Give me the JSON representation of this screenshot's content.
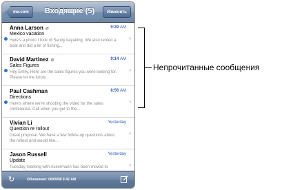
{
  "navbar": {
    "back_label": "me.com",
    "title": "Входящие (5)",
    "edit_label": "Изменить"
  },
  "messages": [
    {
      "sender": "Anna Larson",
      "attachment": true,
      "time": "9:39",
      "ampm": "AM",
      "subject": "Mexico vacation",
      "preview": "Here's a photo I took of Sandy kayaking. We also rented a boat and did a lot of fishing...",
      "unread": true
    },
    {
      "sender": "David Martinez",
      "attachment": true,
      "time": "9:14",
      "ampm": "AM",
      "subject": "Sales Figures",
      "preview": "Hey Emily, Here are the sales figures you were looking for. Please let me know...",
      "unread": true
    },
    {
      "sender": "Paul Cashman",
      "attachment": false,
      "time": "8:56",
      "ampm": "AM",
      "subject": "Directions",
      "preview": "Here's where we're shooting the video for the sales conference. Call when you get to the...",
      "unread": true
    },
    {
      "sender": "Vivian Li",
      "attachment": false,
      "time": "Yesterday",
      "ampm": "",
      "subject": "Question re rollout",
      "preview": "Great proposal. We have a few follow-up questions about the rollout and would like...",
      "unread": false
    },
    {
      "sender": "Jason Russell",
      "attachment": false,
      "time": "Yesterday",
      "ampm": "",
      "subject": "Update",
      "preview": "Tuesday meeting with Ackermann has been moved to Wednesday...",
      "unread": false
    }
  ],
  "toolbar": {
    "updated_text": "Обновлено: 06/09/08 9:42 AM"
  },
  "callout": "Непрочитанные сообщения",
  "colors": {
    "unread_dot": "#2f6fd6",
    "time_blue": "#2a5bbf"
  },
  "icons": {
    "refresh": "refresh-icon",
    "compose": "compose-icon",
    "attachment": "paperclip-icon",
    "chevron": "chevron-right-icon"
  }
}
